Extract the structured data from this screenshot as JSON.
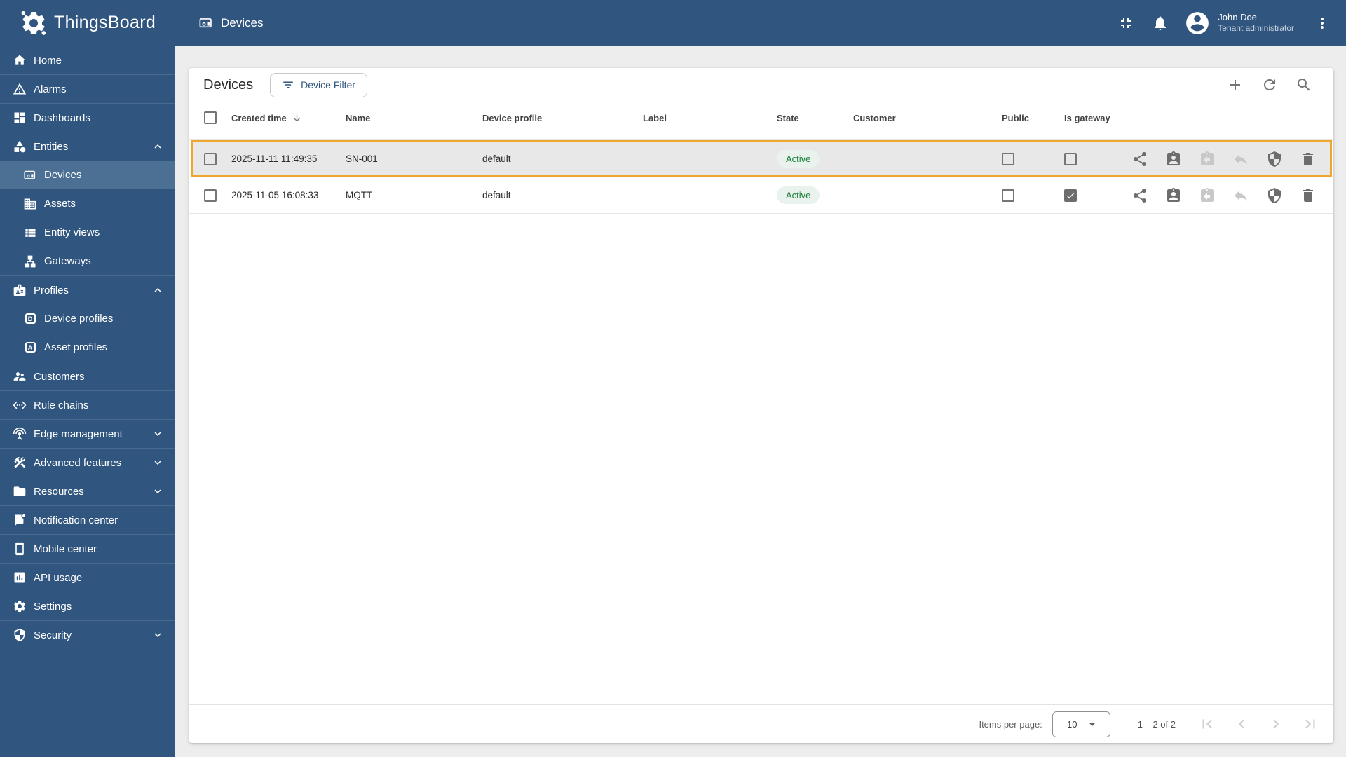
{
  "app": {
    "name": "ThingsBoard"
  },
  "topbar": {
    "breadcrumb": "Devices",
    "user_name": "John Doe",
    "user_role": "Tenant administrator"
  },
  "sidebar": {
    "items": [
      {
        "label": "Home"
      },
      {
        "label": "Alarms"
      },
      {
        "label": "Dashboards"
      },
      {
        "label": "Entities",
        "expanded": true
      },
      {
        "label": "Devices",
        "active": true
      },
      {
        "label": "Assets"
      },
      {
        "label": "Entity views"
      },
      {
        "label": "Gateways"
      },
      {
        "label": "Profiles",
        "expanded": true
      },
      {
        "label": "Device profiles",
        "icon_letter": "D"
      },
      {
        "label": "Asset profiles",
        "icon_letter": "A"
      },
      {
        "label": "Customers"
      },
      {
        "label": "Rule chains"
      },
      {
        "label": "Edge management",
        "expanded": false
      },
      {
        "label": "Advanced features",
        "expanded": false
      },
      {
        "label": "Resources",
        "expanded": false
      },
      {
        "label": "Notification center"
      },
      {
        "label": "Mobile center"
      },
      {
        "label": "API usage"
      },
      {
        "label": "Settings"
      },
      {
        "label": "Security",
        "expanded": false
      }
    ]
  },
  "main": {
    "title": "Devices",
    "filter_button": "Device Filter",
    "table": {
      "columns": [
        "Created time",
        "Name",
        "Device profile",
        "Label",
        "State",
        "Customer",
        "Public",
        "Is gateway"
      ],
      "rows": [
        {
          "created": "2025-11-11 11:49:35",
          "name": "SN-001",
          "profile": "default",
          "label": "",
          "state": "Active",
          "customer": "",
          "public": false,
          "gateway": false,
          "highlighted": true
        },
        {
          "created": "2025-11-05 16:08:33",
          "name": "MQTT",
          "profile": "default",
          "label": "",
          "state": "Active",
          "customer": "",
          "public": false,
          "gateway": true,
          "highlighted": false
        }
      ]
    },
    "pagination": {
      "items_per_page_label": "Items per page:",
      "page_size": "10",
      "range": "1 – 2 of 2"
    }
  },
  "colors": {
    "primary": "#305680",
    "sidebar_active_bg": "#4c7093",
    "row_highlight_border": "#f0a62c",
    "row_highlight_bg": "#e8e8e8",
    "state_active_text": "#198038",
    "state_active_bg": "#e9f2ec"
  }
}
